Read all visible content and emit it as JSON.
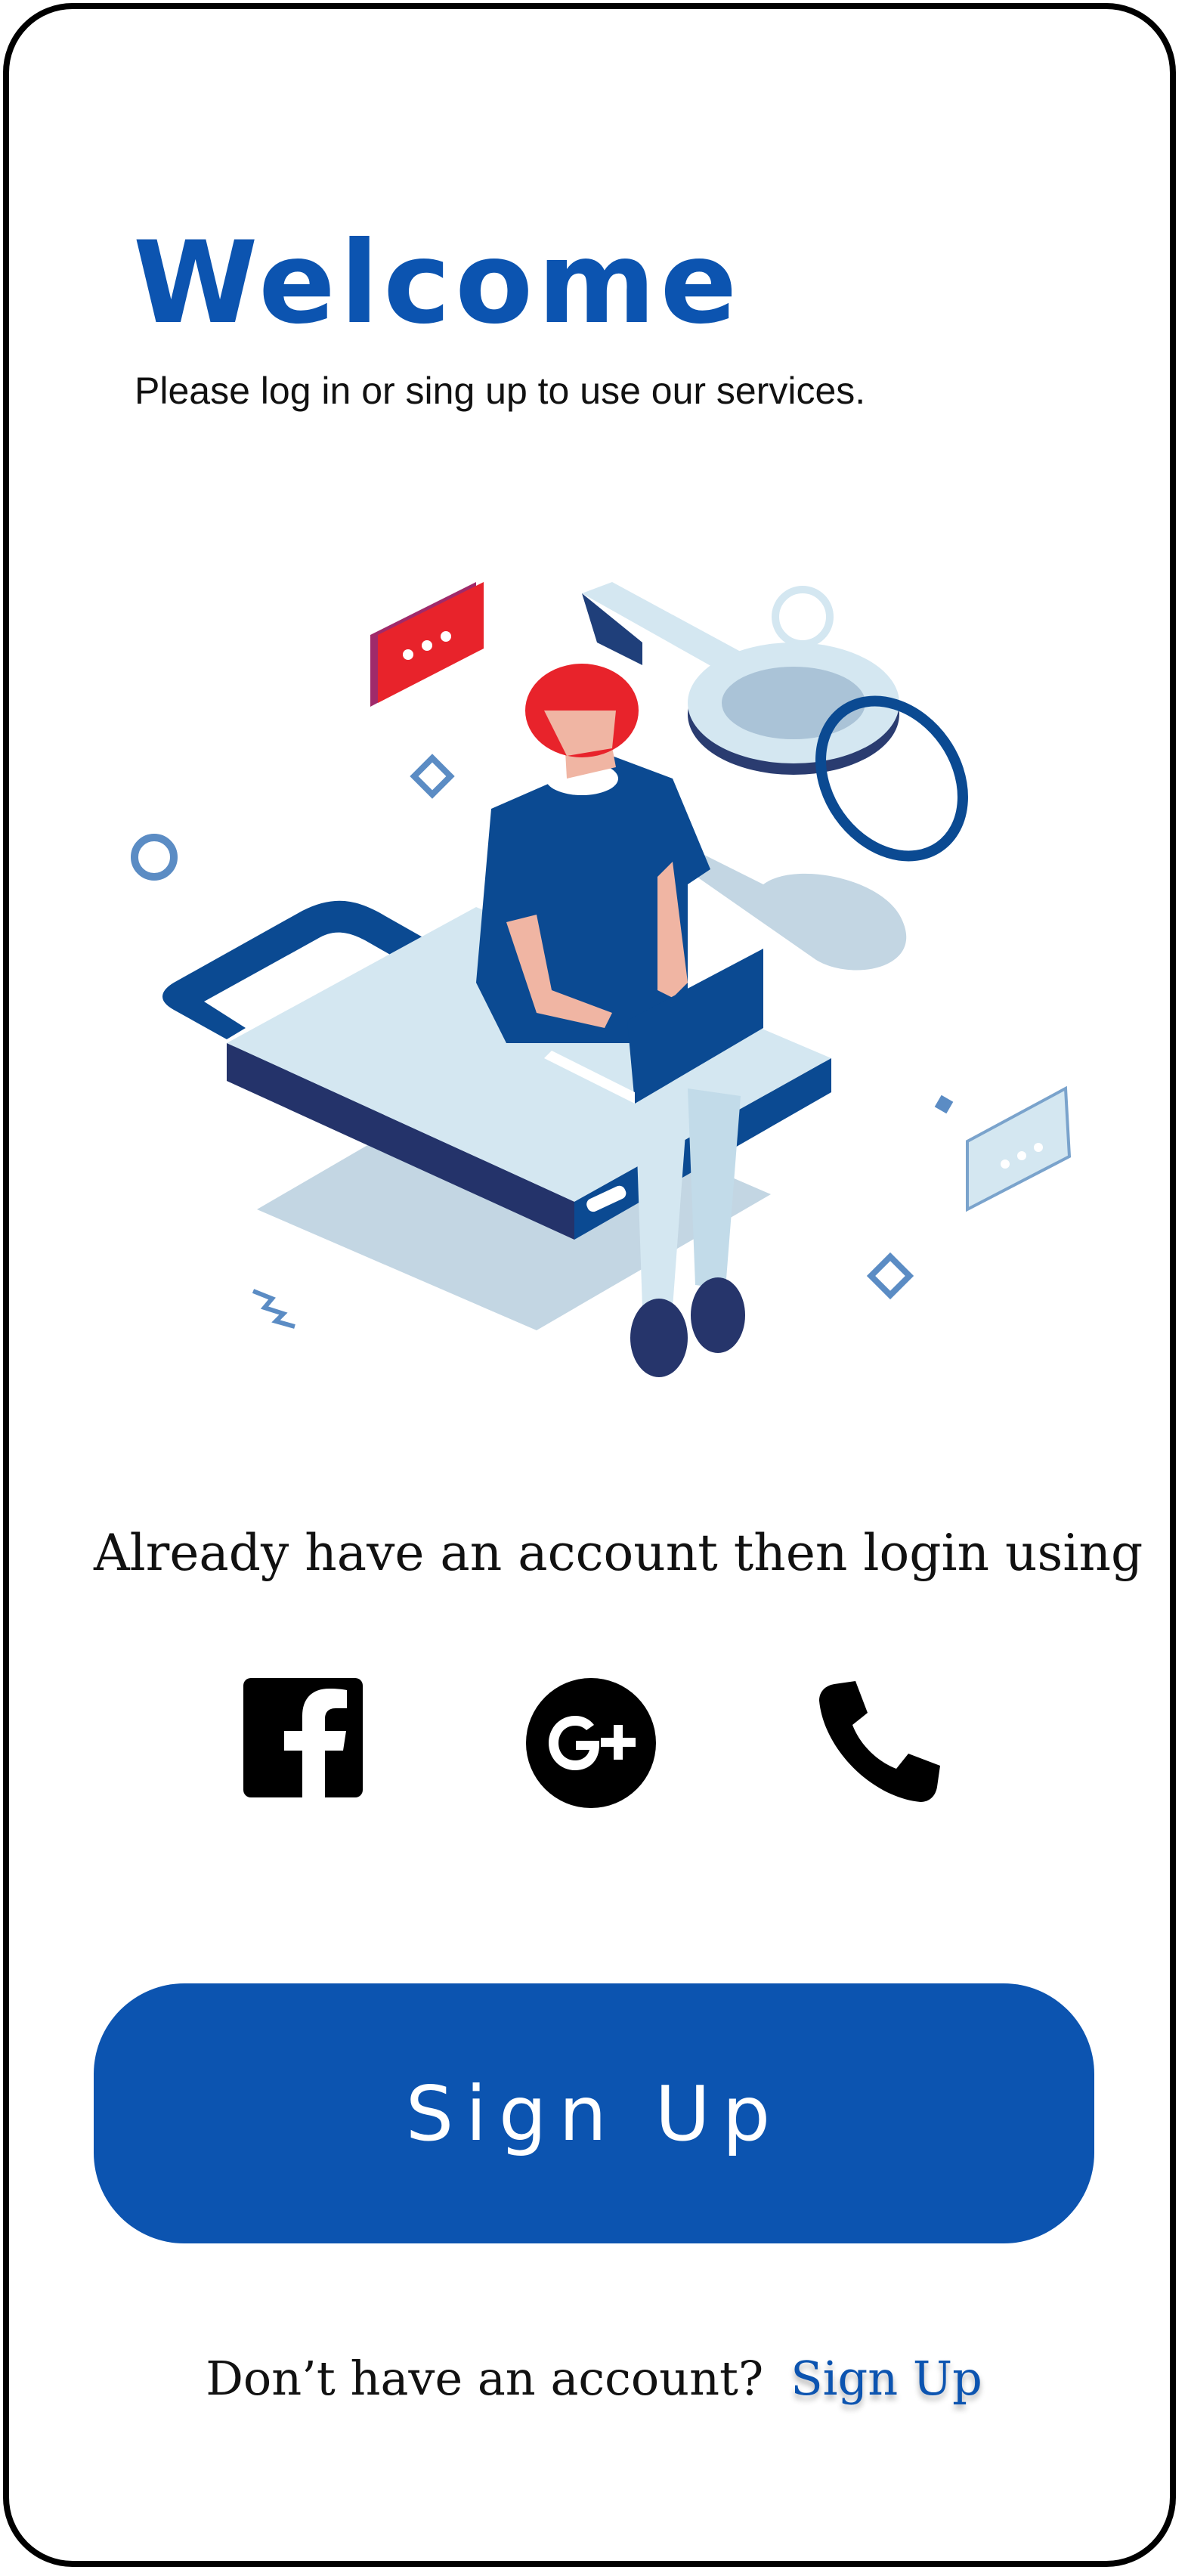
{
  "header": {
    "title": "Welcome",
    "subtitle": "Please log in or sing up to use our services."
  },
  "illustration": {
    "icon": "person-on-lock-with-key-illustration"
  },
  "login": {
    "prompt": "Already have an account then login using",
    "options": [
      {
        "icon": "facebook-icon"
      },
      {
        "icon": "google-plus-icon"
      },
      {
        "icon": "phone-icon"
      }
    ]
  },
  "signup_button": {
    "label": "Sign Up"
  },
  "footer": {
    "text": "Don’t have an account?",
    "link": "Sign Up"
  },
  "colors": {
    "primary": "#0c54b0",
    "background": "#ffffff",
    "text": "#111111",
    "accent_red": "#e8232b"
  }
}
